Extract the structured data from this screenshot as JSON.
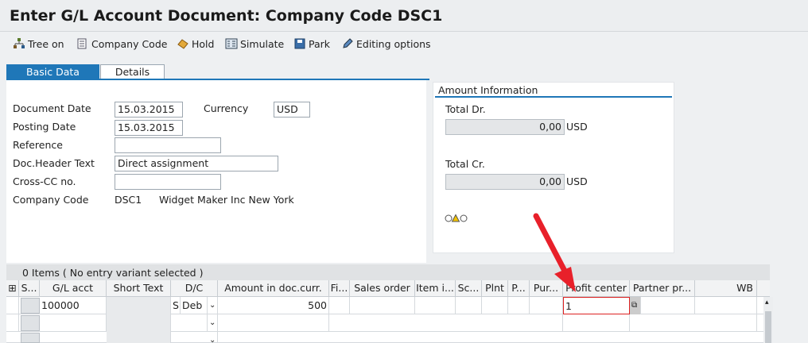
{
  "title": "Enter G/L Account Document: Company Code DSC1",
  "toolbar": [
    {
      "label": "Tree on",
      "icon": "tree-icon"
    },
    {
      "label": "Company Code",
      "icon": "company-code-icon"
    },
    {
      "label": "Hold",
      "icon": "hold-icon"
    },
    {
      "label": "Simulate",
      "icon": "simulate-icon"
    },
    {
      "label": "Park",
      "icon": "park-icon"
    },
    {
      "label": "Editing options",
      "icon": "pencil-icon"
    }
  ],
  "tabs": {
    "basic": "Basic Data",
    "details": "Details"
  },
  "form": {
    "doc_date_label": "Document Date",
    "doc_date": "15.03.2015",
    "currency_label": "Currency",
    "currency": "USD",
    "posting_date_label": "Posting Date",
    "posting_date": "15.03.2015",
    "reference_label": "Reference",
    "reference": "",
    "header_text_label": "Doc.Header Text",
    "header_text": "Direct assignment",
    "crosscc_label": "Cross-CC no.",
    "crosscc": "",
    "company_code_label": "Company Code",
    "company_code": "DSC1",
    "company_name": "Widget Maker Inc New York"
  },
  "amount": {
    "title": "Amount Information",
    "total_dr_label": "Total Dr.",
    "total_dr": "0,00",
    "total_dr_cur": "USD",
    "total_cr_label": "Total Cr.",
    "total_cr": "0,00",
    "total_cr_cur": "USD"
  },
  "grid": {
    "status": "0 Items ( No entry variant selected )",
    "headers": [
      "S...",
      "G/L acct",
      "Short Text",
      "D/C",
      "Amount in doc.curr.",
      "Fi...",
      "Sales order",
      "Item i...",
      "Sc...",
      "Plnt",
      "P...",
      "Pur...",
      "Profit center",
      "Partner pr...",
      "WB"
    ],
    "row1": {
      "gl": "100000",
      "dc_code": "S",
      "dc": "Deb",
      "amount": "500",
      "profit_center": "1"
    }
  },
  "colors": {
    "accent": "#1f77b8",
    "arrow": "#e8202a"
  }
}
